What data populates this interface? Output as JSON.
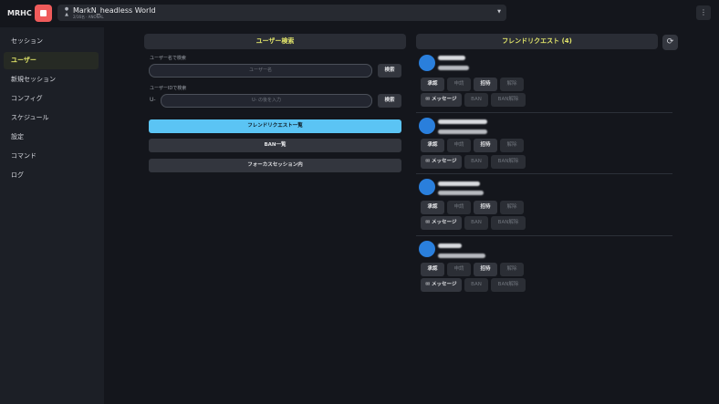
{
  "app": {
    "brand": "MRHC",
    "world_name": "MarkN_headless World",
    "world_sub": "2/16名 · ANONAL",
    "world_icon": "person-icon"
  },
  "sidebar": {
    "items": [
      {
        "label": "セッション",
        "active": false
      },
      {
        "label": "ユーザー",
        "active": true
      },
      {
        "label": "新規セッション",
        "active": false
      },
      {
        "label": "コンフィグ",
        "active": false
      },
      {
        "label": "スケジュール",
        "active": false
      },
      {
        "label": "設定",
        "active": false
      },
      {
        "label": "コマンド",
        "active": false
      },
      {
        "label": "ログ",
        "active": false
      }
    ]
  },
  "user_search": {
    "title": "ユーザー検索",
    "name_label": "ユーザー名で検索",
    "name_placeholder": "ユーザー名",
    "id_label": "ユーザーIDで検索",
    "id_prefix": "U-",
    "id_placeholder": "U- の後を入力",
    "search_button": "検索"
  },
  "actions": {
    "friend_requests": "フレンドリクエスト一覧",
    "ban_list": "BAN一覧",
    "focused_session": "フォーカスセッション内"
  },
  "friend_requests": {
    "title": "フレンドリクエスト (4)",
    "buttons": {
      "accept": "承認",
      "deny": "申請",
      "invite": "招待",
      "unfriend": "解除",
      "message": "✉ メッセージ",
      "ban": "BAN",
      "unban": "BAN解除"
    },
    "colors": {
      "avatar": "#2a7fdc",
      "accent": "#e2e56a",
      "primary": "#5bc4f4",
      "stop": "#ef5b5b"
    }
  }
}
